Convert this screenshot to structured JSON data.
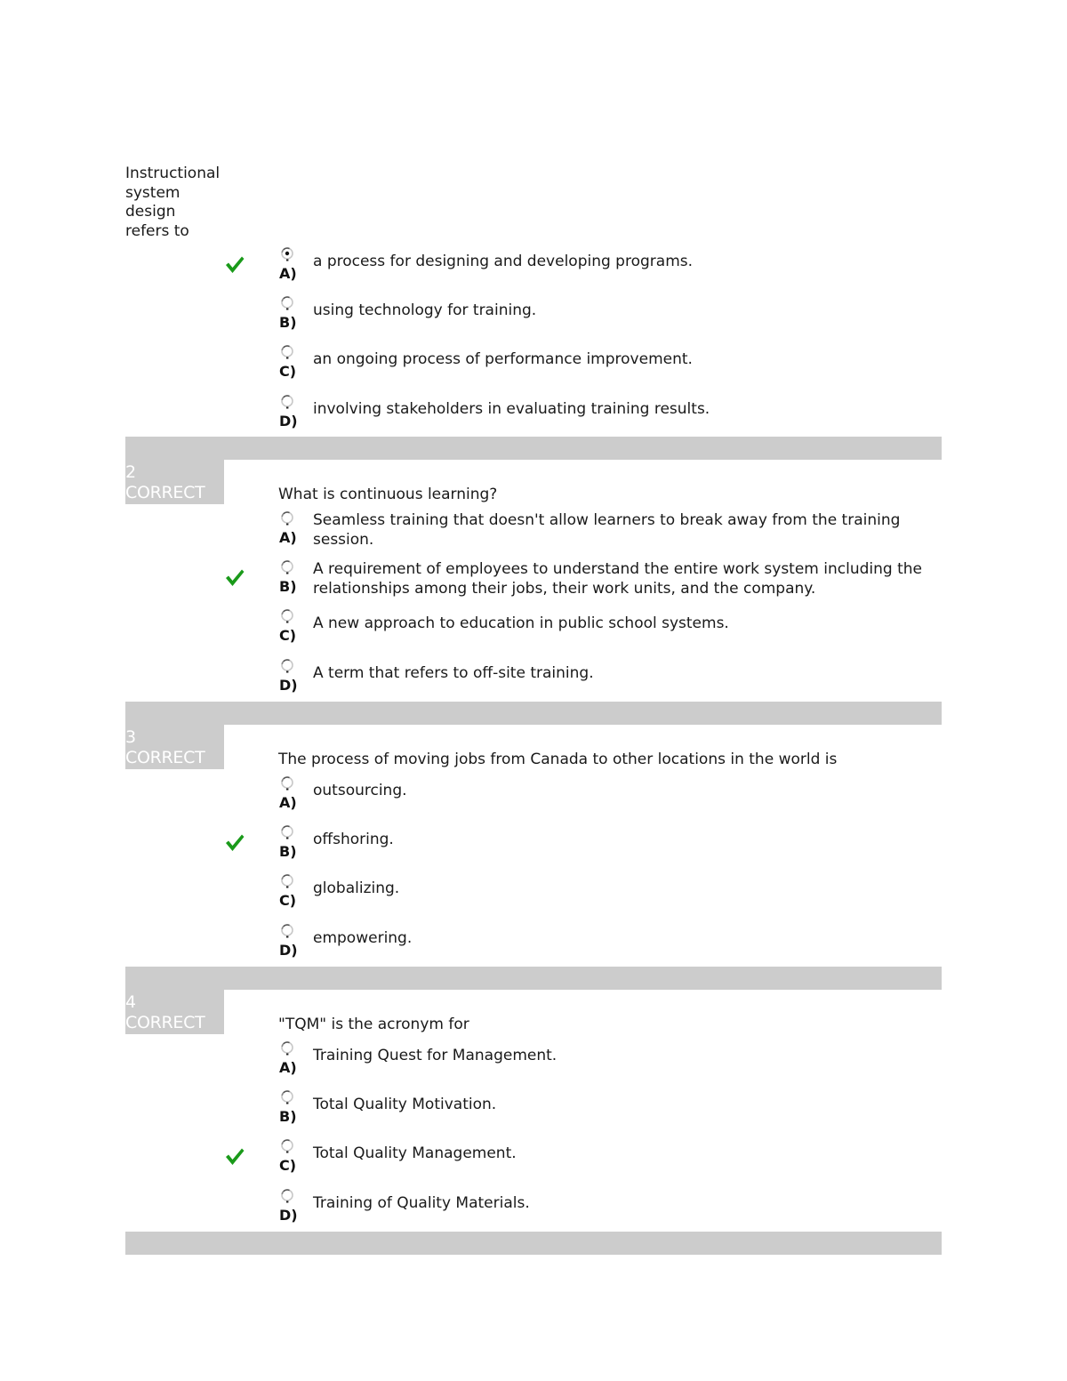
{
  "colors": {
    "separator": "#cccccc",
    "header_text": "#ffffff",
    "check_green": "#1a9a1a",
    "text": "#1a1a1a"
  },
  "questions": [
    {
      "number": "",
      "status": "",
      "stem": "Instructional system design refers to",
      "stem_lines": [
        "Instructional",
        "system",
        "design",
        "refers to"
      ],
      "options": [
        {
          "letter": "A)",
          "text": "a process for designing and developing programs.",
          "correct": true,
          "selected": true
        },
        {
          "letter": "B)",
          "text": "using technology for training.",
          "correct": false,
          "selected": false
        },
        {
          "letter": "C)",
          "text": "an ongoing process of performance improvement.",
          "correct": false,
          "selected": false
        },
        {
          "letter": "D)",
          "text": "involving stakeholders in evaluating training results.",
          "correct": false,
          "selected": false
        }
      ]
    },
    {
      "number": "2",
      "status": "CORRECT",
      "stem": "What is continuous learning?",
      "options": [
        {
          "letter": "A)",
          "text": "Seamless training that doesn't allow learners to break away from the training session.",
          "correct": false,
          "selected": false
        },
        {
          "letter": "B)",
          "text": "A requirement of employees to understand the entire work system including the relationships among their jobs, their work units, and the company.",
          "correct": true,
          "selected": false
        },
        {
          "letter": "C)",
          "text": "A new approach to education in public school systems.",
          "correct": false,
          "selected": false
        },
        {
          "letter": "D)",
          "text": "A term that refers to off-site training.",
          "correct": false,
          "selected": false
        }
      ]
    },
    {
      "number": "3",
      "status": "CORRECT",
      "stem": "The process of moving jobs from Canada to other locations in the world is",
      "options": [
        {
          "letter": "A)",
          "text": "outsourcing.",
          "correct": false,
          "selected": false
        },
        {
          "letter": "B)",
          "text": "offshoring.",
          "correct": true,
          "selected": false
        },
        {
          "letter": "C)",
          "text": "globalizing.",
          "correct": false,
          "selected": false
        },
        {
          "letter": "D)",
          "text": "empowering.",
          "correct": false,
          "selected": false
        }
      ]
    },
    {
      "number": "4",
      "status": "CORRECT",
      "stem": "\"TQM\" is the acronym for",
      "options": [
        {
          "letter": "A)",
          "text": "Training Quest for Management.",
          "correct": false,
          "selected": false
        },
        {
          "letter": "B)",
          "text": "Total Quality Motivation.",
          "correct": false,
          "selected": false
        },
        {
          "letter": "C)",
          "text": "Total Quality Management.",
          "correct": true,
          "selected": false
        },
        {
          "letter": "D)",
          "text": "Training of Quality Materials.",
          "correct": false,
          "selected": false
        }
      ]
    }
  ]
}
